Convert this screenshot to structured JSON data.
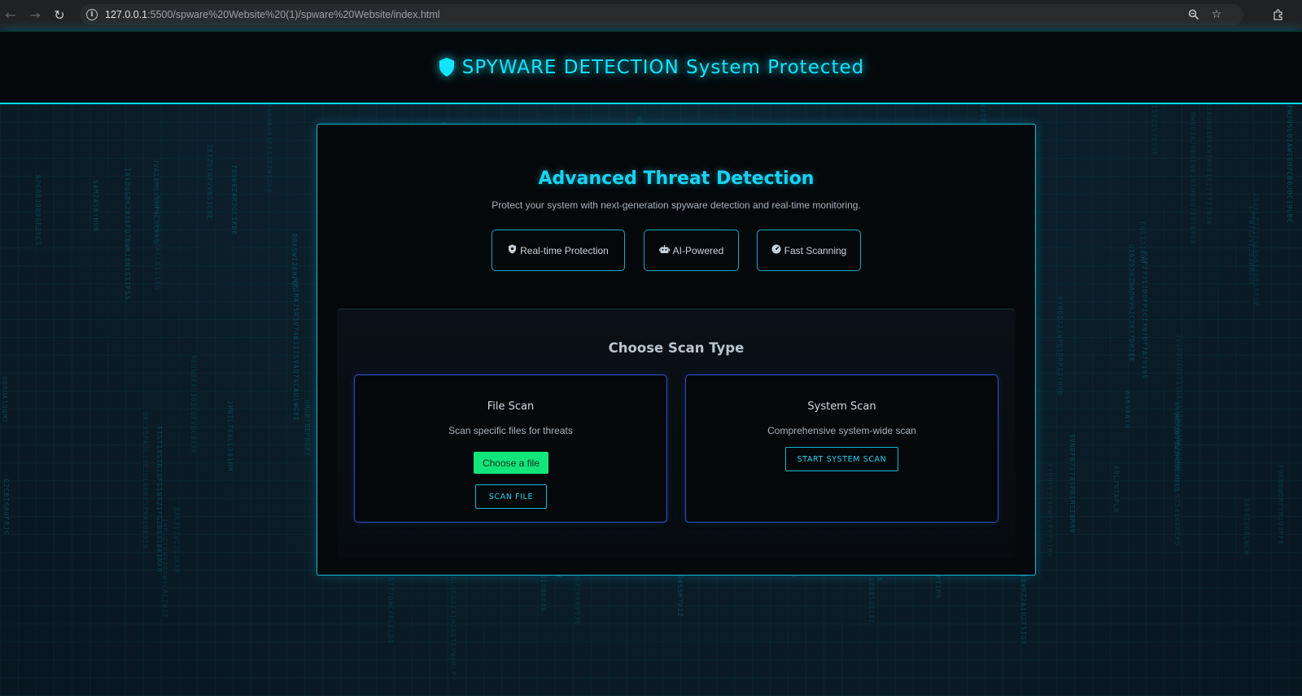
{
  "browser": {
    "url_host": "127.0.0.1",
    "url_path": ":5500/spware%20Website%20(1)/spware%20Website/index.html"
  },
  "header": {
    "title": "SPYWARE DETECTION System Protected"
  },
  "hero": {
    "title": "Advanced Threat Detection",
    "subtitle": "Protect your system with next-generation spyware detection and real-time monitoring."
  },
  "features": [
    {
      "icon": "shield-icon",
      "label": "Real-time Protection"
    },
    {
      "icon": "robot-icon",
      "label": "AI-Powered"
    },
    {
      "icon": "gauge-icon",
      "label": "Fast Scanning"
    }
  ],
  "scan": {
    "section_title": "Choose Scan Type",
    "file_scan": {
      "title": "File Scan",
      "description": "Scan specific files for threats",
      "choose_label": "Choose a file",
      "scan_button": "SCAN FILE"
    },
    "system_scan": {
      "title": "System Scan",
      "description": "Comprehensive system-wide scan",
      "scan_button": "START SYSTEM SCAN"
    }
  },
  "colors": {
    "accent": "#12e4fb",
    "card_border": "#2c53c9",
    "file_button": "#13e57a",
    "background": "#0a1a24"
  }
}
